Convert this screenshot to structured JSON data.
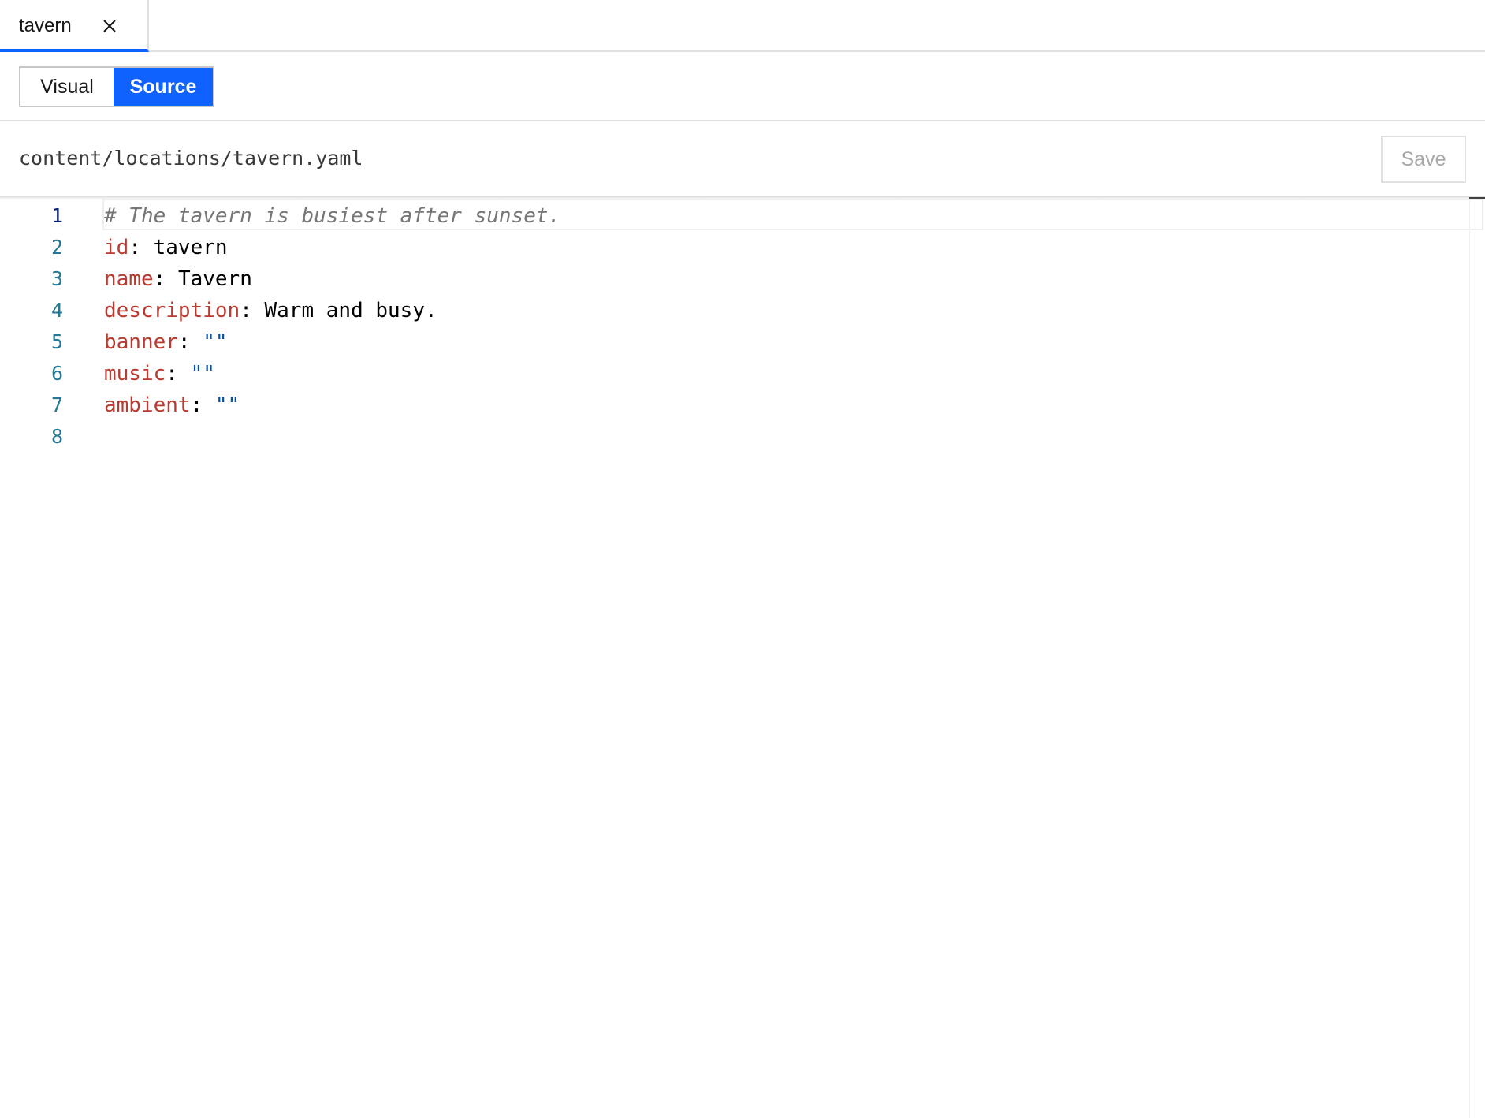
{
  "tab": {
    "title": "tavern",
    "close_icon": "close-icon"
  },
  "view_toggle": {
    "options": [
      {
        "label": "Visual",
        "selected": false
      },
      {
        "label": "Source",
        "selected": true
      }
    ]
  },
  "file": {
    "path": "content/locations/tavern.yaml",
    "save_label": "Save",
    "save_enabled": false
  },
  "editor": {
    "language": "yaml",
    "active_line": 1,
    "lines": [
      {
        "number": "1",
        "comment": "# The tavern is busiest after sunset."
      },
      {
        "number": "2",
        "key": "id",
        "sep": ": ",
        "value": "tavern"
      },
      {
        "number": "3",
        "key": "name",
        "sep": ": ",
        "value": "Tavern"
      },
      {
        "number": "4",
        "key": "description",
        "sep": ": ",
        "value": "Warm and busy."
      },
      {
        "number": "5",
        "key": "banner",
        "sep": ": ",
        "string": "\"\""
      },
      {
        "number": "6",
        "key": "music",
        "sep": ": ",
        "string": "\"\""
      },
      {
        "number": "7",
        "key": "ambient",
        "sep": ": ",
        "string": "\"\""
      },
      {
        "number": "8"
      }
    ]
  },
  "colors": {
    "accent": "#0f62fe",
    "yaml_key": "#b83a30",
    "yaml_string": "#0451a5",
    "comment": "#767676",
    "line_number": "#237893"
  }
}
